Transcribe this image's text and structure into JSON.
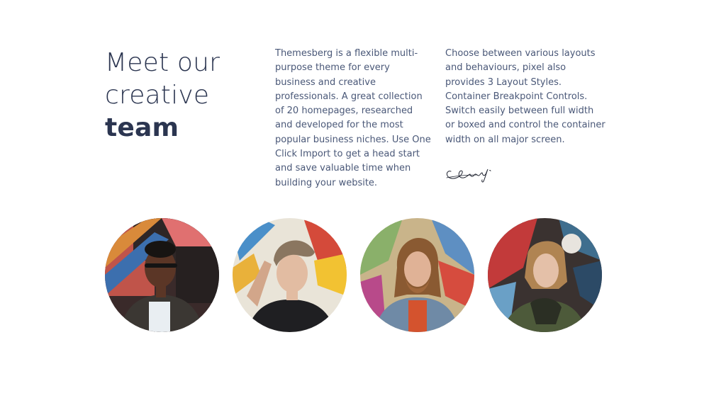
{
  "heading": {
    "line1": "Meet our",
    "line2": "creative",
    "line3": "team"
  },
  "paragraph_1": "Themesberg is a flexible multi-purpose theme for every business and creative professionals. A great collection of 20 homepages, researched and developed for the most popular business niches. Use One Click Import to get a head start and save valuable time when building your website.",
  "paragraph_2": "Choose between various layouts and behaviours, pixel also provides 3 Layout Styles. Container Breakpoint Controls. Switch easily between full width or boxed and control the container width on all major screen.",
  "colors": {
    "heading": "#2b3550",
    "body_text": "#4a5878",
    "background": "#ffffff"
  }
}
